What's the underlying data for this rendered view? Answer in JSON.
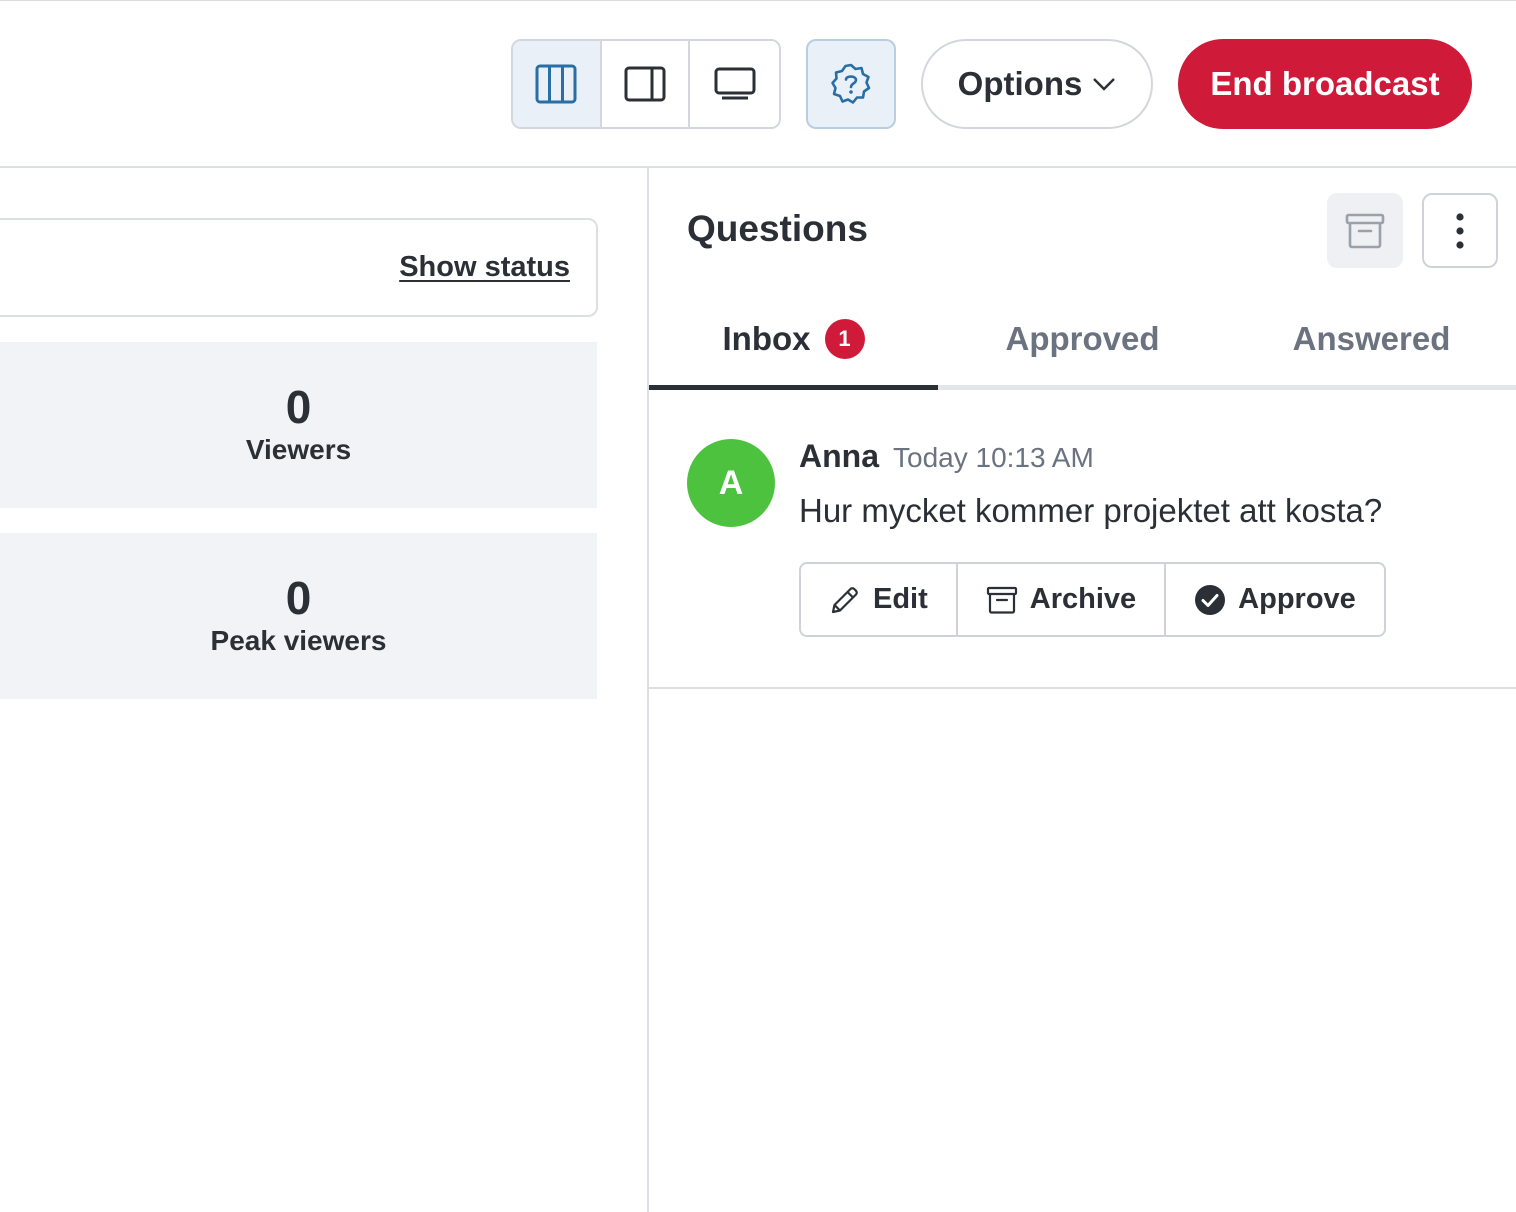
{
  "header": {
    "layout_buttons": [
      {
        "name": "three-column-layout",
        "icon": "columns-icon",
        "active": true
      },
      {
        "name": "sidebar-layout",
        "icon": "sidebar-right-icon",
        "active": false
      },
      {
        "name": "presentation-layout",
        "icon": "monitor-icon",
        "active": false
      }
    ],
    "help_icon": "question-badge-icon",
    "options_label": "Options",
    "end_broadcast_label": "End broadcast",
    "colors": {
      "end_broadcast": "#d01a3a",
      "active_layout_bg": "#e9f0f7",
      "icon_blue": "#2a6ea6"
    }
  },
  "status": {
    "show_status_label": "Show status"
  },
  "stats": [
    {
      "value": "0",
      "label": "Viewers"
    },
    {
      "value": "0",
      "label": "Peak viewers"
    }
  ],
  "questions_panel": {
    "title": "Questions",
    "tabs": [
      {
        "label": "Inbox",
        "badge": "1",
        "active": true
      },
      {
        "label": "Approved",
        "active": false
      },
      {
        "label": "Answered",
        "active": false
      }
    ],
    "items": [
      {
        "avatar_initial": "A",
        "avatar_color": "#4cc23f",
        "author": "Anna",
        "time": "Today 10:13 AM",
        "text": "Hur mycket kommer projektet att kosta?",
        "actions": [
          {
            "label": "Edit",
            "icon": "pencil-icon"
          },
          {
            "label": "Archive",
            "icon": "archive-icon"
          },
          {
            "label": "Approve",
            "icon": "check-circle-icon"
          }
        ]
      }
    ]
  }
}
